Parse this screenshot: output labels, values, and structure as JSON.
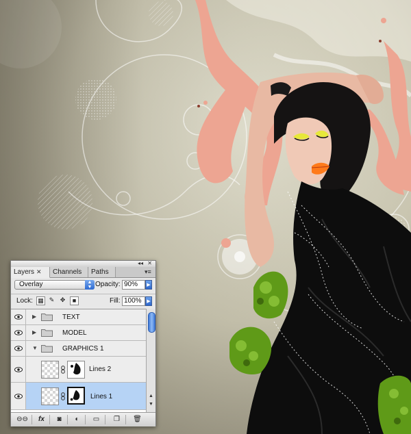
{
  "panel": {
    "tabs": [
      {
        "label": "Layers",
        "close": "✕",
        "active": true
      },
      {
        "label": "Channels",
        "active": false
      },
      {
        "label": "Paths",
        "active": false
      }
    ],
    "blend_mode": "Overlay",
    "opacity_label": "Opacity:",
    "opacity_value": "90%",
    "lock_label": "Lock:",
    "fill_label": "Fill:",
    "fill_value": "100%",
    "layers": [
      {
        "name": "TEXT",
        "type": "group",
        "expanded": false,
        "visible": true
      },
      {
        "name": "MODEL",
        "type": "group",
        "expanded": false,
        "visible": true
      },
      {
        "name": "GRAPHICS 1",
        "type": "group",
        "expanded": true,
        "visible": true
      },
      {
        "name": "Lines 2",
        "type": "layer-with-mask",
        "visible": true
      },
      {
        "name": "Lines 1",
        "type": "layer-with-mask",
        "visible": true,
        "selected": true
      }
    ],
    "bottom_buttons": [
      "link-layers",
      "fx",
      "add-mask",
      "adjustment-layer",
      "new-group",
      "new-layer",
      "delete-layer"
    ],
    "bottom_labels": {
      "fx": "fx"
    }
  },
  "colors": {
    "selected_row": "#b6d3f5",
    "accent_blue": "#2f6bd1",
    "paint_splash": "#eda592",
    "foliage": "#6aa51c"
  }
}
